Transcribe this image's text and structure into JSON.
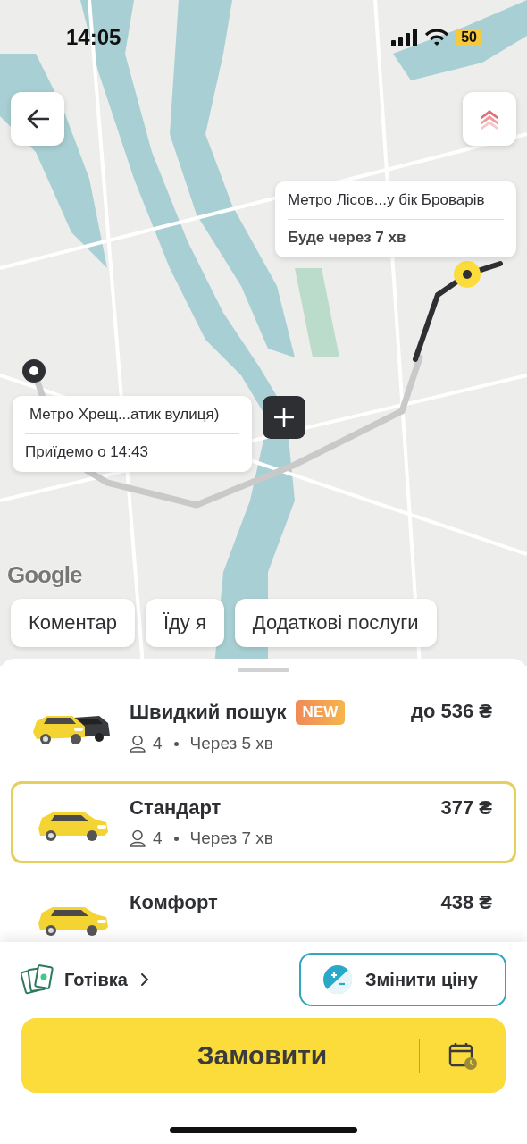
{
  "status_bar": {
    "time": "14:05",
    "battery": "50"
  },
  "map": {
    "attribution": "Google",
    "pickup": {
      "title": "Метро Лісов...у бік Броварів",
      "subtitle": "Буде через 7 хв"
    },
    "destination": {
      "title": "Метро Хрещ...атик вулиця)",
      "subtitle": "Приїдемо о 14:43"
    }
  },
  "chips": [
    "Коментар",
    "Їду я",
    "Додаткові послуги"
  ],
  "tariffs": [
    {
      "kind": "multi",
      "name": "Швидкий пошук",
      "badge": "NEW",
      "price": "до 536 ₴",
      "seats": "4",
      "eta": "Через 5 хв",
      "selected": false
    },
    {
      "kind": "single",
      "name": "Стандарт",
      "price": "377 ₴",
      "seats": "4",
      "eta": "Через 7 хв",
      "selected": true
    },
    {
      "kind": "single",
      "name": "Комфорт",
      "price": "438 ₴",
      "selected": false
    }
  ],
  "payment": {
    "label": "Готівка"
  },
  "change_price": "Змінити ціну",
  "order": "Замовити"
}
